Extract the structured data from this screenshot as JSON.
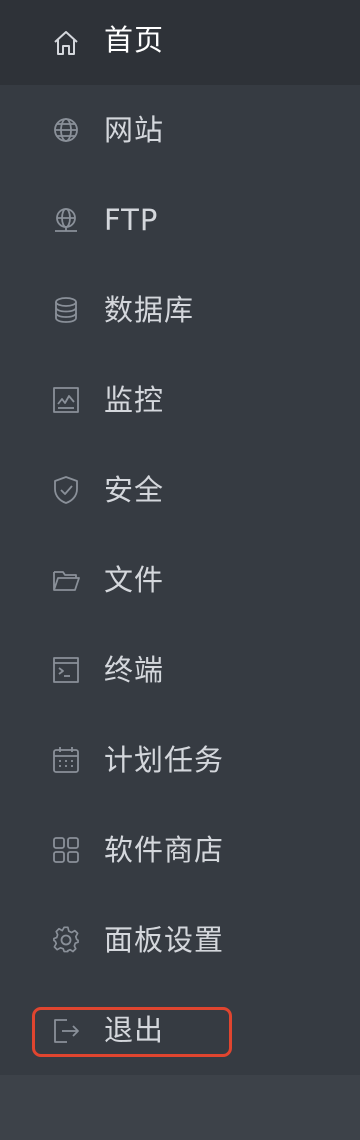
{
  "menu": {
    "items": [
      {
        "label": "首页",
        "icon": "home-icon"
      },
      {
        "label": "网站",
        "icon": "globe-icon"
      },
      {
        "label": "FTP",
        "icon": "ftp-icon"
      },
      {
        "label": "数据库",
        "icon": "database-icon"
      },
      {
        "label": "监控",
        "icon": "monitor-icon"
      },
      {
        "label": "安全",
        "icon": "shield-icon"
      },
      {
        "label": "文件",
        "icon": "folder-icon"
      },
      {
        "label": "终端",
        "icon": "terminal-icon"
      },
      {
        "label": "计划任务",
        "icon": "calendar-icon"
      },
      {
        "label": "软件商店",
        "icon": "app-grid-icon"
      },
      {
        "label": "面板设置",
        "icon": "gear-icon"
      },
      {
        "label": "退出",
        "icon": "logout-icon"
      }
    ]
  },
  "colors": {
    "sidebar_bg": "#363b42",
    "active_bg": "#2e3238",
    "label_color": "#d4d7dc",
    "icon_color": "#8a9099",
    "highlight_border": "#e0452f"
  }
}
